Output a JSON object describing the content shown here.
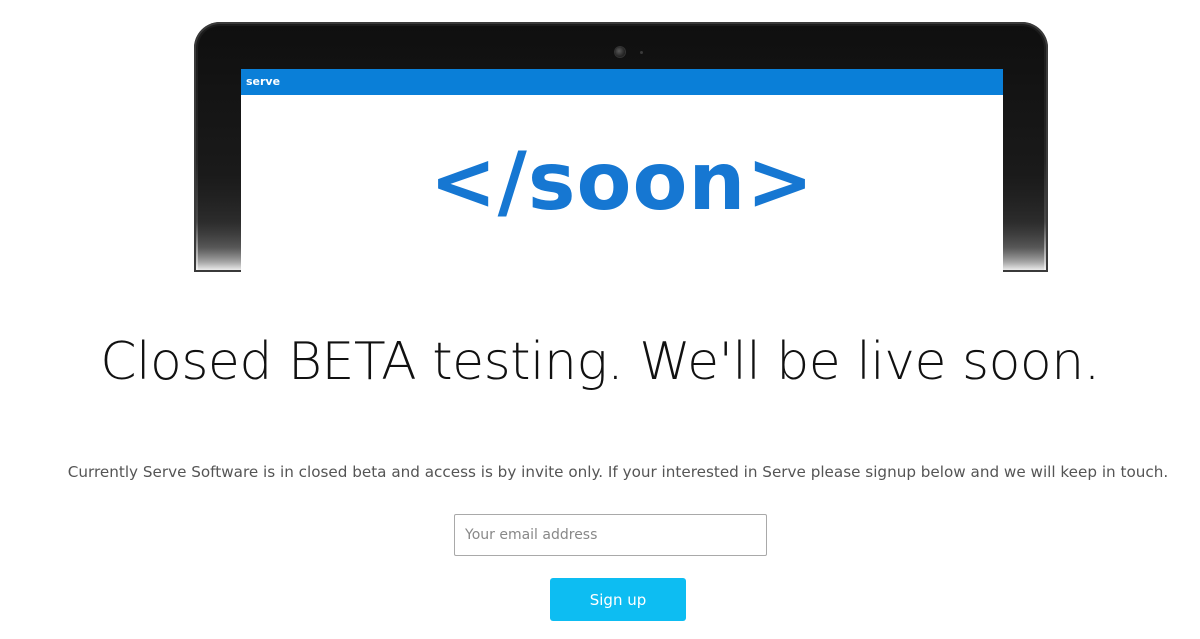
{
  "device_screen": {
    "brand": "serve",
    "hero_text": "</soon>",
    "accent_color": "#0a7fd8",
    "hero_color": "#1677d2"
  },
  "main": {
    "headline": "Closed BETA testing. We'll be live soon.",
    "description": "Currently Serve Software is in closed beta and access is by invite only. If your interested in Serve please signup below and we will keep in touch.",
    "email_placeholder": "Your email address",
    "signup_label": "Sign up",
    "button_color": "#0dbdf2"
  }
}
